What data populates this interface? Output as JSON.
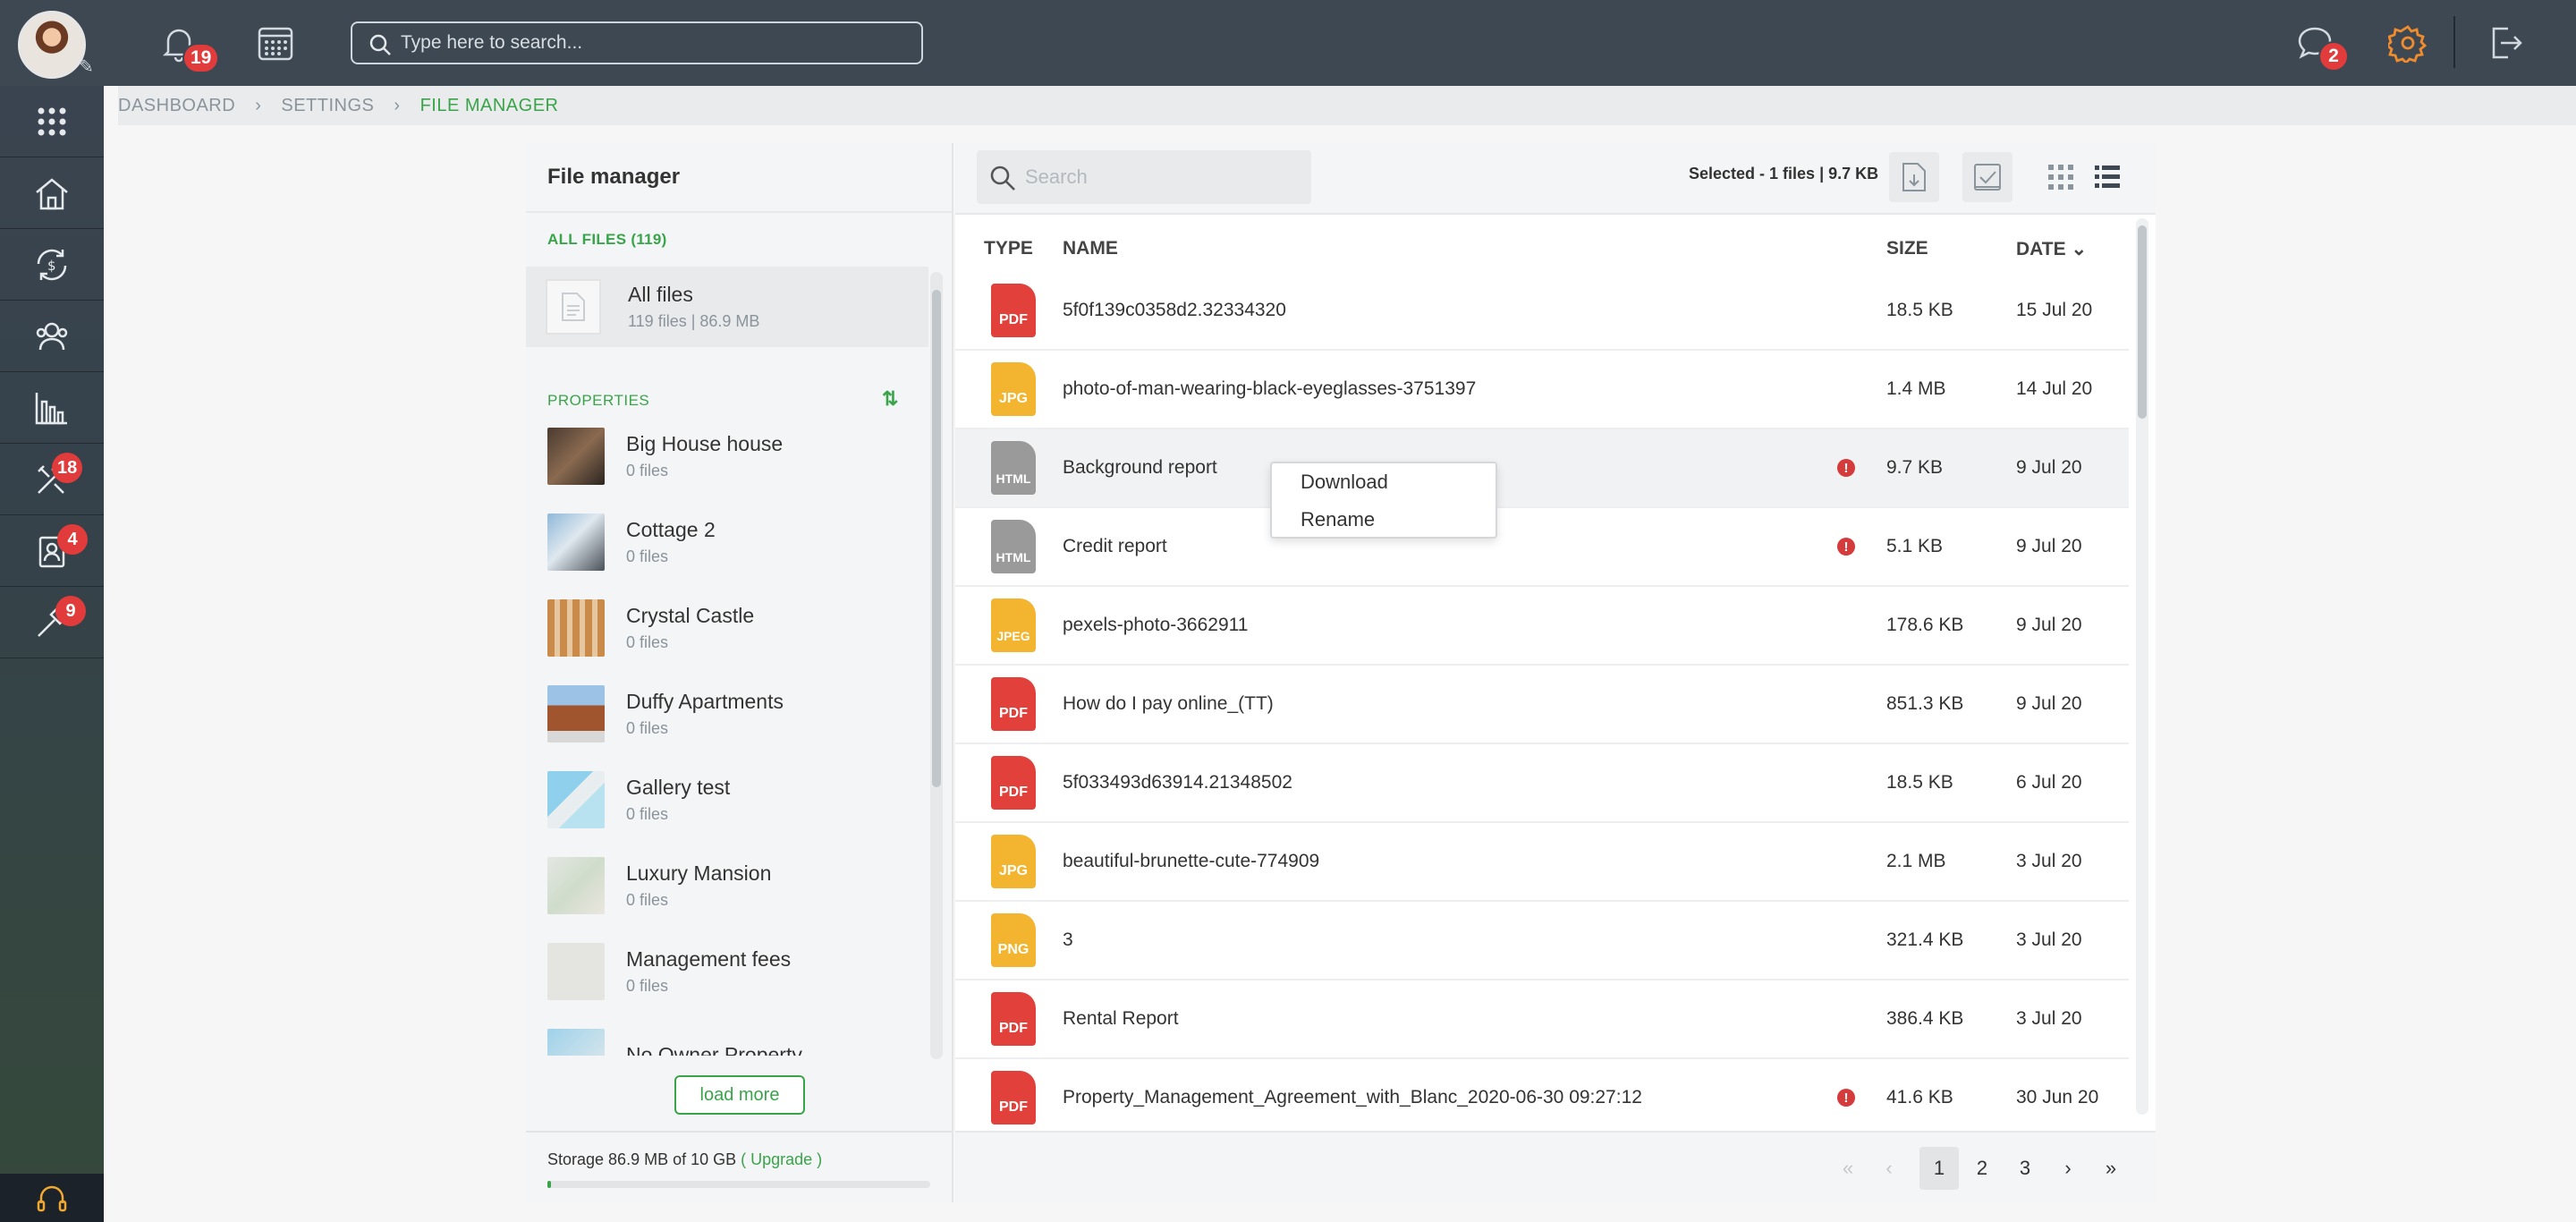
{
  "topbar": {
    "notifications_count": "19",
    "search_placeholder": "Type here to search...",
    "messages_count": "2"
  },
  "sidebar": {
    "badges": {
      "tools": "18",
      "contacts": "4",
      "maintenance": "9"
    }
  },
  "breadcrumb": [
    "DASHBOARD",
    "SETTINGS",
    "FILE MANAGER"
  ],
  "left_panel": {
    "title": "File manager",
    "all_files_label": "ALL FILES (119)",
    "all_files_title": "All files",
    "all_files_sub": "119 files | 86.9 MB",
    "properties_label": "PROPERTIES",
    "properties": [
      {
        "name": "Big House house",
        "files": "0 files"
      },
      {
        "name": "Cottage 2",
        "files": "0 files"
      },
      {
        "name": "Crystal Castle",
        "files": "0 files"
      },
      {
        "name": "Duffy Apartments",
        "files": "0 files"
      },
      {
        "name": "Gallery test",
        "files": "0 files"
      },
      {
        "name": "Luxury Mansion",
        "files": "0 files"
      },
      {
        "name": "Management fees",
        "files": "0 files"
      },
      {
        "name": "No Owner Property",
        "files": ""
      }
    ],
    "load_more": "load more",
    "storage_text": "Storage 86.9 MB of 10 GB",
    "upgrade": "( Upgrade )",
    "storage_fraction": 0.0087
  },
  "main": {
    "search_placeholder": "Search",
    "selected_info": "Selected - 1 files | 9.7 KB",
    "columns": {
      "type": "TYPE",
      "name": "NAME",
      "size": "SIZE",
      "date": "DATE"
    },
    "files": [
      {
        "type": "PDF",
        "name": "5f0f139c0358d2.32334320",
        "size": "18.5 KB",
        "date": "15 Jul 20",
        "warn": false
      },
      {
        "type": "JPG",
        "name": "photo-of-man-wearing-black-eyeglasses-3751397",
        "size": "1.4 MB",
        "date": "14 Jul 20",
        "warn": false
      },
      {
        "type": "HTML",
        "name": "Background report",
        "size": "9.7 KB",
        "date": "9 Jul 20",
        "warn": true
      },
      {
        "type": "HTML",
        "name": "Credit report",
        "size": "5.1 KB",
        "date": "9 Jul 20",
        "warn": true
      },
      {
        "type": "JPEG",
        "name": "pexels-photo-3662911",
        "size": "178.6 KB",
        "date": "9 Jul 20",
        "warn": false
      },
      {
        "type": "PDF",
        "name": "How do I pay online_(TT)",
        "size": "851.3 KB",
        "date": "9 Jul 20",
        "warn": false
      },
      {
        "type": "PDF",
        "name": "5f033493d63914.21348502",
        "size": "18.5 KB",
        "date": "6 Jul 20",
        "warn": false
      },
      {
        "type": "JPG",
        "name": "beautiful-brunette-cute-774909",
        "size": "2.1 MB",
        "date": "3 Jul 20",
        "warn": false
      },
      {
        "type": "PNG",
        "name": "3",
        "size": "321.4 KB",
        "date": "3 Jul 20",
        "warn": false
      },
      {
        "type": "PDF",
        "name": "Rental Report",
        "size": "386.4 KB",
        "date": "3 Jul 20",
        "warn": false
      },
      {
        "type": "PDF",
        "name": "Property_Management_Agreement_with_Blanc_2020-06-30 09:27:12",
        "size": "41.6 KB",
        "date": "30 Jun 20",
        "warn": true
      }
    ],
    "pages": [
      "1",
      "2",
      "3"
    ],
    "current_page": "1"
  },
  "context_menu": {
    "download": "Download",
    "rename": "Rename"
  },
  "colors": {
    "topbar": "#3d4853",
    "accent": "#3aa44a",
    "pdf": "#e2403a",
    "jpg": "#f3b52f",
    "html": "#9a9a9a",
    "badge": "#e23b3b"
  }
}
